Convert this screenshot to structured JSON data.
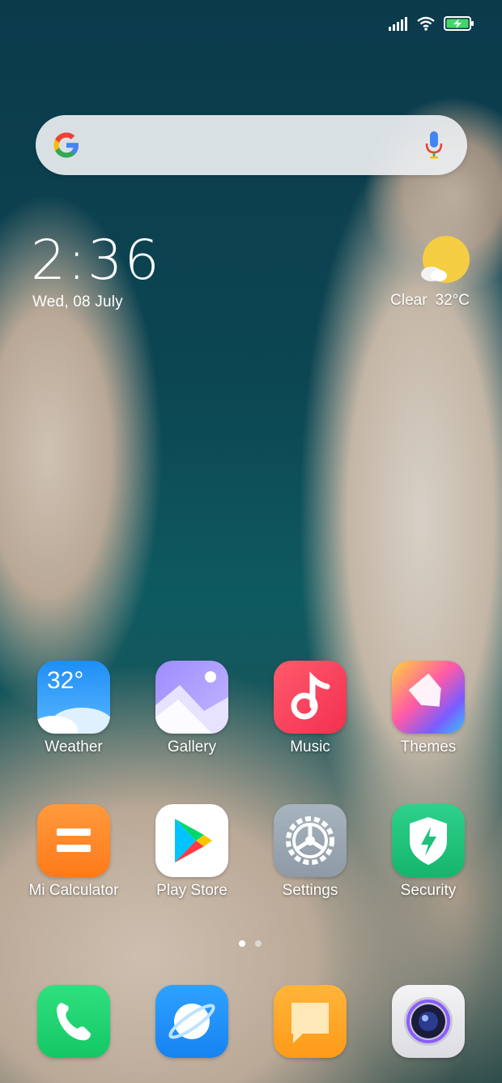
{
  "status_bar": {
    "signal": "signal-icon",
    "wifi": "wifi-icon",
    "battery": "battery-charging-icon"
  },
  "search": {
    "logo": "google-g-logo",
    "mic": "mic-icon"
  },
  "clock": {
    "time": "2:36",
    "date": "Wed, 08 July"
  },
  "weather": {
    "condition": "Clear",
    "temp": "32°C",
    "icon": "sun-cloud-icon"
  },
  "apps": [
    {
      "label": "Weather",
      "badge": "32°"
    },
    {
      "label": "Gallery"
    },
    {
      "label": "Music"
    },
    {
      "label": "Themes"
    },
    {
      "label": "Mi Calculator"
    },
    {
      "label": "Play Store"
    },
    {
      "label": "Settings"
    },
    {
      "label": "Security"
    }
  ],
  "dock": [
    {
      "name": "Phone",
      "icon": "phone-icon"
    },
    {
      "name": "Browser",
      "icon": "browser-icon"
    },
    {
      "name": "Messages",
      "icon": "messages-icon"
    },
    {
      "name": "Camera",
      "icon": "camera-icon"
    }
  ],
  "page_indicator": {
    "pages": 2,
    "current": 1
  }
}
